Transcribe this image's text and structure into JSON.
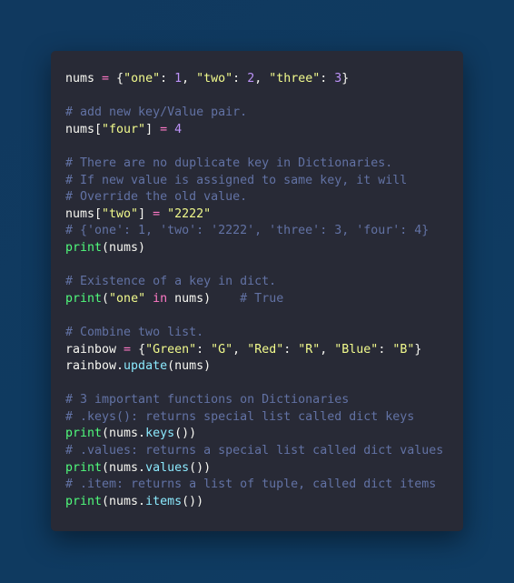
{
  "theme": {
    "background": "#0f3a60",
    "panel": "#282a36",
    "colors": {
      "comment": "#6272a4",
      "string": "#f1fa8c",
      "number": "#bd93f9",
      "operator": "#ff79c6",
      "builtin": "#50fa7b",
      "method": "#8be9fd",
      "plain": "#f8f8f2"
    }
  },
  "code": {
    "language": "python",
    "lines": [
      [
        {
          "t": "p",
          "v": "nums "
        },
        {
          "t": "o",
          "v": "="
        },
        {
          "t": "p",
          "v": " {"
        },
        {
          "t": "s",
          "v": "\"one\""
        },
        {
          "t": "p",
          "v": ": "
        },
        {
          "t": "n",
          "v": "1"
        },
        {
          "t": "p",
          "v": ", "
        },
        {
          "t": "s",
          "v": "\"two\""
        },
        {
          "t": "p",
          "v": ": "
        },
        {
          "t": "n",
          "v": "2"
        },
        {
          "t": "p",
          "v": ", "
        },
        {
          "t": "s",
          "v": "\"three\""
        },
        {
          "t": "p",
          "v": ": "
        },
        {
          "t": "n",
          "v": "3"
        },
        {
          "t": "p",
          "v": "}"
        }
      ],
      [],
      [
        {
          "t": "c",
          "v": "# add new key/Value pair."
        }
      ],
      [
        {
          "t": "p",
          "v": "nums["
        },
        {
          "t": "s",
          "v": "\"four\""
        },
        {
          "t": "p",
          "v": "] "
        },
        {
          "t": "o",
          "v": "="
        },
        {
          "t": "p",
          "v": " "
        },
        {
          "t": "n",
          "v": "4"
        }
      ],
      [],
      [
        {
          "t": "c",
          "v": "# There are no duplicate key in Dictionaries."
        }
      ],
      [
        {
          "t": "c",
          "v": "# If new value is assigned to same key, it will"
        }
      ],
      [
        {
          "t": "c",
          "v": "# Override the old value."
        }
      ],
      [
        {
          "t": "p",
          "v": "nums["
        },
        {
          "t": "s",
          "v": "\"two\""
        },
        {
          "t": "p",
          "v": "] "
        },
        {
          "t": "o",
          "v": "="
        },
        {
          "t": "p",
          "v": " "
        },
        {
          "t": "s",
          "v": "\"2222\""
        }
      ],
      [
        {
          "t": "c",
          "v": "# {'one': 1, 'two': '2222', 'three': 3, 'four': 4}"
        }
      ],
      [
        {
          "t": "f",
          "v": "print"
        },
        {
          "t": "p",
          "v": "(nums)"
        }
      ],
      [],
      [
        {
          "t": "c",
          "v": "# Existence of a key in dict."
        }
      ],
      [
        {
          "t": "f",
          "v": "print"
        },
        {
          "t": "p",
          "v": "("
        },
        {
          "t": "s",
          "v": "\"one\""
        },
        {
          "t": "p",
          "v": " "
        },
        {
          "t": "o",
          "v": "in"
        },
        {
          "t": "p",
          "v": " nums)    "
        },
        {
          "t": "c",
          "v": "# True"
        }
      ],
      [],
      [
        {
          "t": "c",
          "v": "# Combine two list."
        }
      ],
      [
        {
          "t": "p",
          "v": "rainbow "
        },
        {
          "t": "o",
          "v": "="
        },
        {
          "t": "p",
          "v": " {"
        },
        {
          "t": "s",
          "v": "\"Green\""
        },
        {
          "t": "p",
          "v": ": "
        },
        {
          "t": "s",
          "v": "\"G\""
        },
        {
          "t": "p",
          "v": ", "
        },
        {
          "t": "s",
          "v": "\"Red\""
        },
        {
          "t": "p",
          "v": ": "
        },
        {
          "t": "s",
          "v": "\"R\""
        },
        {
          "t": "p",
          "v": ", "
        },
        {
          "t": "s",
          "v": "\"Blue\""
        },
        {
          "t": "p",
          "v": ": "
        },
        {
          "t": "s",
          "v": "\"B\""
        },
        {
          "t": "p",
          "v": "}"
        }
      ],
      [
        {
          "t": "p",
          "v": "rainbow."
        },
        {
          "t": "m",
          "v": "update"
        },
        {
          "t": "p",
          "v": "(nums)"
        }
      ],
      [],
      [
        {
          "t": "c",
          "v": "# 3 important functions on Dictionaries"
        }
      ],
      [
        {
          "t": "c",
          "v": "# .keys(): returns special list called dict keys"
        }
      ],
      [
        {
          "t": "f",
          "v": "print"
        },
        {
          "t": "p",
          "v": "(nums."
        },
        {
          "t": "m",
          "v": "keys"
        },
        {
          "t": "p",
          "v": "())"
        }
      ],
      [
        {
          "t": "c",
          "v": "# .values: returns a special list called dict values"
        }
      ],
      [
        {
          "t": "f",
          "v": "print"
        },
        {
          "t": "p",
          "v": "(nums."
        },
        {
          "t": "m",
          "v": "values"
        },
        {
          "t": "p",
          "v": "())"
        }
      ],
      [
        {
          "t": "c",
          "v": "# .item: returns a list of tuple, called dict items"
        }
      ],
      [
        {
          "t": "f",
          "v": "print"
        },
        {
          "t": "p",
          "v": "(nums."
        },
        {
          "t": "m",
          "v": "items"
        },
        {
          "t": "p",
          "v": "())"
        }
      ]
    ]
  }
}
